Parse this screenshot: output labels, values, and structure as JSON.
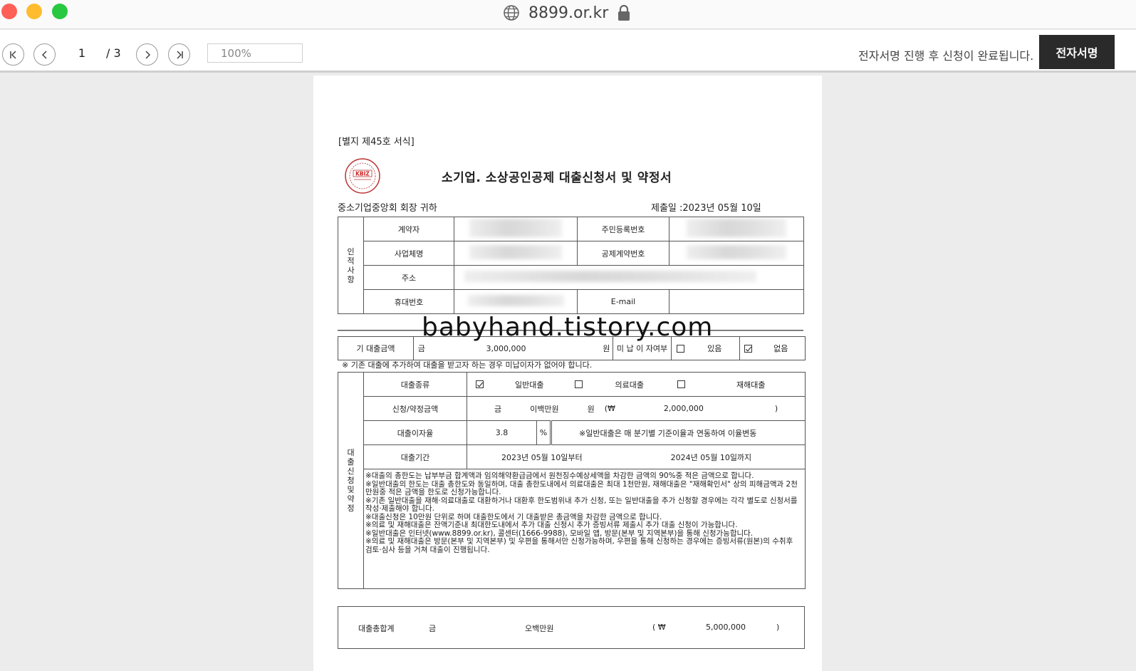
{
  "browser": {
    "url": "8899.or.kr",
    "icons": [
      "globe-icon",
      "lock-icon"
    ]
  },
  "toolbar": {
    "current_page": "1",
    "total_pages": "/ 3",
    "zoom": "100%",
    "notice": "전자서명 진행 후 신청이 완료됩니다.",
    "sign_button": "전자서명"
  },
  "document": {
    "form_no": "[별지 제45호 서식]",
    "seal_text": "KBIZ",
    "title": "소기업.  소상공인공제 대출신청서 및 약정서",
    "addressee": "중소기업중앙회 회장   귀하",
    "submit_date": "제출일 :2023년 05월 10일",
    "personal": {
      "section": "인적사항",
      "contractor": "계약자",
      "business_name": "사업체명",
      "resident_no": "주민등록번호",
      "contract_no": "공제계약번호",
      "address": "주소",
      "mobile": "휴대번호",
      "email": "E-mail"
    },
    "existing_loan": {
      "label": "기 대출금액",
      "prefix": "금",
      "amount": "3,000,000",
      "unit": "원",
      "unpaid_label": "미 납 이 자여부",
      "yes": "있음",
      "no": "없음",
      "yes_checked": false,
      "no_checked": true
    },
    "existing_note": "※ 기존 대출에 추가하여 대출을 받고자 하는 경우 미납이자가 없어야 합니다.",
    "watermark": "babyhand.tistory.com",
    "loan": {
      "section": "대출신청 및 약정",
      "type_label": "대출종류",
      "types": [
        {
          "label": "일반대출",
          "checked": true
        },
        {
          "label": "의료대출",
          "checked": false
        },
        {
          "label": "재해대출",
          "checked": false
        }
      ],
      "amount_label": "신청/약정금액",
      "amount_prefix": "금",
      "amount_words": "이백만원",
      "amount_unit": "원",
      "amount_open": "(₩",
      "amount_number": "2,000,000",
      "amount_close": ")",
      "rate_label": "대출이자율",
      "rate": "3.8",
      "rate_unit": "%",
      "rate_note": "※일반대출은 매 분기별 기준이율과 연동하여 이율변동",
      "period_label": "대출기간",
      "period_from": "2023년 05월 10일부터",
      "period_to": "2024년 05월 10일까지",
      "notes": [
        "※대출의 총한도는 납부부금 합계액과 임의해약환급금에서 원천징수예상세액을 차감한 금액의 90%중 적은 금액으로 합니다.",
        "※일반대출의 한도는 대출 총한도와 동일하며, 대출 총한도내에서 의료대출은 최대 1천만원, 재해대출은 \"재해확인서\" 상의 피해금액과 2천만원중 적은 금액을 한도로 신청가능합니다.",
        "※기존 일반대출을 재해·의료대출로 대환하거나 대환후 한도범위내 추가 신청, 또는 일반대출을 추가 신청할 경우에는 각각 별도로 신청서를 작성·제출해야 합니다.",
        "※대출신청은 10만원 단위로 하며 대출한도에서 기 대출받은 총금액을 차감한 금액으로 합니다.",
        "※의료 및 재해대출은 잔액기준내 최대한도내에서 추가 대출 신청시 추가 증빙서류 제출시 추가 대출 신청이 가능합니다.",
        "※일반대출은 인터넷(www.8899.or.kr), 콜센터(1666-9988), 모바일 앱, 방문(본부 및 지역본부)을 통해 신청가능합니다.",
        "※의료 및 재해대출은 방문(본부 및 지역본부) 및 우편을 통해서만 신청가능하며, 우편을 통해 신청하는 경우에는 증빙서류(원본)의 수취후 검토·심사 등을 거쳐 대출이 진행됩니다."
      ]
    },
    "total": {
      "label": "대출총합계",
      "prefix": "금",
      "words": "오백만원",
      "open": "( ₩",
      "number": "5,000,000",
      "close": ")"
    }
  },
  "colors": {
    "sign_button_bg": "#2a2a2a",
    "traffic_red": "#fe5f57",
    "traffic_yellow": "#febc2e",
    "traffic_green": "#28c840"
  }
}
